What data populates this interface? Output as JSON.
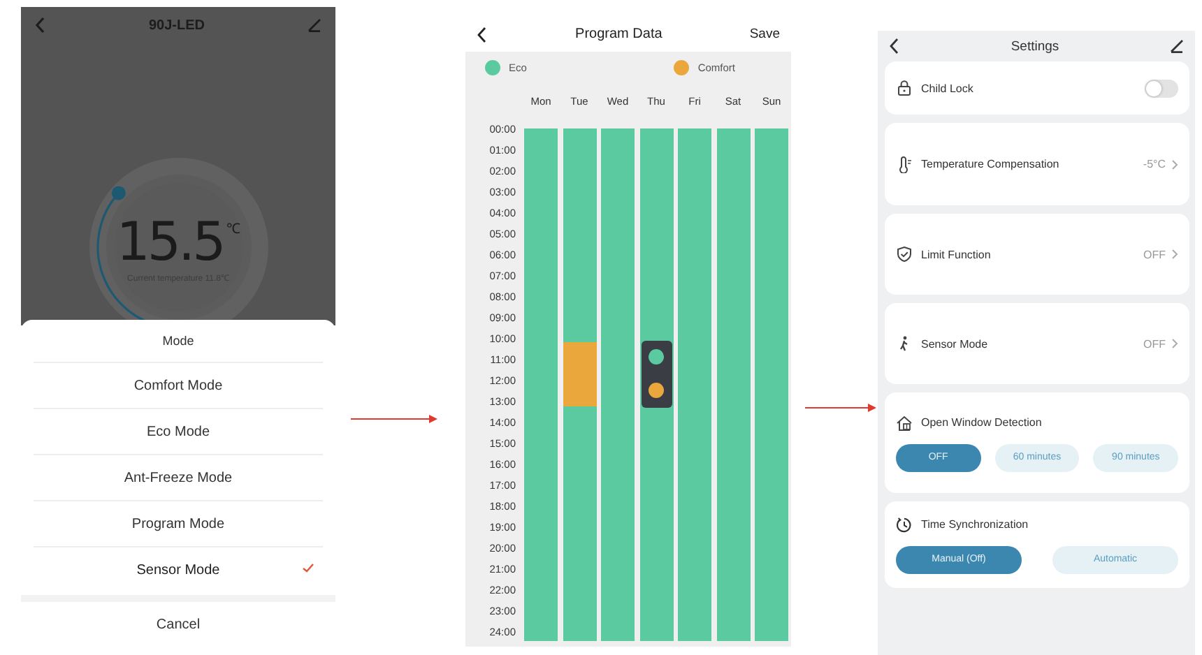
{
  "mode_screen": {
    "title": "90J-LED",
    "dial": {
      "setpoint": "15.5",
      "unit": "℃",
      "current": "Current temperature 11.8℃"
    },
    "sheet": {
      "title": "Mode",
      "options": [
        {
          "label": "Comfort Mode",
          "selected": false
        },
        {
          "label": "Eco Mode",
          "selected": false
        },
        {
          "label": "Ant-Freeze Mode",
          "selected": false
        },
        {
          "label": "Program Mode",
          "selected": false
        },
        {
          "label": "Sensor Mode",
          "selected": true
        }
      ],
      "cancel": "Cancel"
    }
  },
  "program_screen": {
    "title": "Program Data",
    "save": "Save",
    "legend": [
      {
        "kind": "eco",
        "label": "Eco",
        "color": "#5ccaa0"
      },
      {
        "kind": "comfort",
        "label": "Comfort",
        "color": "#eaa83c"
      }
    ],
    "hours": [
      "00:00",
      "01:00",
      "02:00",
      "03:00",
      "04:00",
      "05:00",
      "06:00",
      "07:00",
      "08:00",
      "09:00",
      "10:00",
      "11:00",
      "12:00",
      "13:00",
      "14:00",
      "15:00",
      "16:00",
      "17:00",
      "18:00",
      "19:00",
      "20:00",
      "21:00",
      "22:00",
      "23:00",
      "24:00"
    ],
    "days": [
      {
        "label": "Mon",
        "slots": [
          {
            "kind": "eco"
          },
          {
            "kind": "eco"
          },
          {
            "kind": "eco"
          },
          {
            "kind": "eco"
          },
          {
            "kind": "eco"
          },
          {
            "kind": "eco"
          },
          {
            "kind": "eco"
          },
          {
            "kind": "eco"
          },
          {
            "kind": "eco"
          },
          {
            "kind": "eco"
          },
          {
            "kind": "eco"
          },
          {
            "kind": "eco"
          },
          {
            "kind": "eco"
          },
          {
            "kind": "eco"
          },
          {
            "kind": "eco"
          },
          {
            "kind": "eco"
          },
          {
            "kind": "eco"
          },
          {
            "kind": "eco"
          },
          {
            "kind": "eco"
          },
          {
            "kind": "eco"
          },
          {
            "kind": "eco"
          },
          {
            "kind": "eco"
          },
          {
            "kind": "eco"
          },
          {
            "kind": "eco"
          }
        ]
      },
      {
        "label": "Tue",
        "slots": [
          {
            "kind": "eco"
          },
          {
            "kind": "eco"
          },
          {
            "kind": "eco"
          },
          {
            "kind": "eco"
          },
          {
            "kind": "eco"
          },
          {
            "kind": "eco"
          },
          {
            "kind": "eco"
          },
          {
            "kind": "eco"
          },
          {
            "kind": "eco"
          },
          {
            "kind": "eco"
          },
          {
            "kind": "comfort"
          },
          {
            "kind": "comfort"
          },
          {
            "kind": "comfort"
          },
          {
            "kind": "eco"
          },
          {
            "kind": "eco"
          },
          {
            "kind": "eco"
          },
          {
            "kind": "eco"
          },
          {
            "kind": "eco"
          },
          {
            "kind": "eco"
          },
          {
            "kind": "eco"
          },
          {
            "kind": "eco"
          },
          {
            "kind": "eco"
          },
          {
            "kind": "eco"
          },
          {
            "kind": "eco"
          }
        ]
      },
      {
        "label": "Wed",
        "slots": [
          {
            "kind": "eco"
          },
          {
            "kind": "eco"
          },
          {
            "kind": "eco"
          },
          {
            "kind": "eco"
          },
          {
            "kind": "eco"
          },
          {
            "kind": "eco"
          },
          {
            "kind": "eco"
          },
          {
            "kind": "eco"
          },
          {
            "kind": "eco"
          },
          {
            "kind": "eco"
          },
          {
            "kind": "eco"
          },
          {
            "kind": "eco"
          },
          {
            "kind": "eco"
          },
          {
            "kind": "eco"
          },
          {
            "kind": "eco"
          },
          {
            "kind": "eco"
          },
          {
            "kind": "eco"
          },
          {
            "kind": "eco"
          },
          {
            "kind": "eco"
          },
          {
            "kind": "eco"
          },
          {
            "kind": "eco"
          },
          {
            "kind": "eco"
          },
          {
            "kind": "eco"
          },
          {
            "kind": "eco"
          }
        ]
      },
      {
        "label": "Thu",
        "slots": [
          {
            "kind": "eco"
          },
          {
            "kind": "eco"
          },
          {
            "kind": "eco"
          },
          {
            "kind": "eco"
          },
          {
            "kind": "eco"
          },
          {
            "kind": "eco"
          },
          {
            "kind": "eco"
          },
          {
            "kind": "eco"
          },
          {
            "kind": "eco"
          },
          {
            "kind": "eco"
          },
          {
            "kind": "eco"
          },
          {
            "kind": "eco"
          },
          {
            "kind": "eco"
          },
          {
            "kind": "eco"
          },
          {
            "kind": "eco"
          },
          {
            "kind": "eco"
          },
          {
            "kind": "eco"
          },
          {
            "kind": "eco"
          },
          {
            "kind": "eco"
          },
          {
            "kind": "eco"
          },
          {
            "kind": "eco"
          },
          {
            "kind": "eco"
          },
          {
            "kind": "eco"
          },
          {
            "kind": "eco"
          }
        ]
      },
      {
        "label": "Fri",
        "slots": [
          {
            "kind": "eco"
          },
          {
            "kind": "eco"
          },
          {
            "kind": "eco"
          },
          {
            "kind": "eco"
          },
          {
            "kind": "eco"
          },
          {
            "kind": "eco"
          },
          {
            "kind": "eco"
          },
          {
            "kind": "eco"
          },
          {
            "kind": "eco"
          },
          {
            "kind": "eco"
          },
          {
            "kind": "eco"
          },
          {
            "kind": "eco"
          },
          {
            "kind": "eco"
          },
          {
            "kind": "eco"
          },
          {
            "kind": "eco"
          },
          {
            "kind": "eco"
          },
          {
            "kind": "eco"
          },
          {
            "kind": "eco"
          },
          {
            "kind": "eco"
          },
          {
            "kind": "eco"
          },
          {
            "kind": "eco"
          },
          {
            "kind": "eco"
          },
          {
            "kind": "eco"
          },
          {
            "kind": "eco"
          }
        ]
      },
      {
        "label": "Sat",
        "slots": [
          {
            "kind": "eco"
          },
          {
            "kind": "eco"
          },
          {
            "kind": "eco"
          },
          {
            "kind": "eco"
          },
          {
            "kind": "eco"
          },
          {
            "kind": "eco"
          },
          {
            "kind": "eco"
          },
          {
            "kind": "eco"
          },
          {
            "kind": "eco"
          },
          {
            "kind": "eco"
          },
          {
            "kind": "eco"
          },
          {
            "kind": "eco"
          },
          {
            "kind": "eco"
          },
          {
            "kind": "eco"
          },
          {
            "kind": "eco"
          },
          {
            "kind": "eco"
          },
          {
            "kind": "eco"
          },
          {
            "kind": "eco"
          },
          {
            "kind": "eco"
          },
          {
            "kind": "eco"
          },
          {
            "kind": "eco"
          },
          {
            "kind": "eco"
          },
          {
            "kind": "eco"
          },
          {
            "kind": "eco"
          }
        ]
      },
      {
        "label": "Sun",
        "slots": [
          {
            "kind": "eco"
          },
          {
            "kind": "eco"
          },
          {
            "kind": "eco"
          },
          {
            "kind": "eco"
          },
          {
            "kind": "eco"
          },
          {
            "kind": "eco"
          },
          {
            "kind": "eco"
          },
          {
            "kind": "eco"
          },
          {
            "kind": "eco"
          },
          {
            "kind": "eco"
          },
          {
            "kind": "eco"
          },
          {
            "kind": "eco"
          },
          {
            "kind": "eco"
          },
          {
            "kind": "eco"
          },
          {
            "kind": "eco"
          },
          {
            "kind": "eco"
          },
          {
            "kind": "eco"
          },
          {
            "kind": "eco"
          },
          {
            "kind": "eco"
          },
          {
            "kind": "eco"
          },
          {
            "kind": "eco"
          },
          {
            "kind": "eco"
          },
          {
            "kind": "eco"
          },
          {
            "kind": "eco"
          }
        ]
      }
    ],
    "picker": {
      "options": [
        {
          "kind": "eco"
        },
        {
          "kind": "comfort"
        }
      ]
    }
  },
  "settings_screen": {
    "title": "Settings",
    "rows": [
      {
        "kind": "toggle",
        "label": "Child Lock",
        "on": false
      },
      {
        "kind": "value",
        "label": "Temperature Compensation",
        "value": "-5°C"
      },
      {
        "kind": "value",
        "label": "Limit Function",
        "value": "OFF"
      },
      {
        "kind": "value",
        "label": "Sensor Mode",
        "value": "OFF"
      },
      {
        "kind": "options",
        "label": "Open Window Detection",
        "options": [
          {
            "label": "OFF",
            "selected": true
          },
          {
            "label": "60 minutes",
            "selected": false
          },
          {
            "label": "90 minutes",
            "selected": false
          }
        ]
      },
      {
        "kind": "options",
        "label": "Time Synchronization",
        "options": [
          {
            "label": "Manual (Off)",
            "selected": true
          },
          {
            "label": "Automatic",
            "selected": false
          }
        ]
      }
    ]
  }
}
